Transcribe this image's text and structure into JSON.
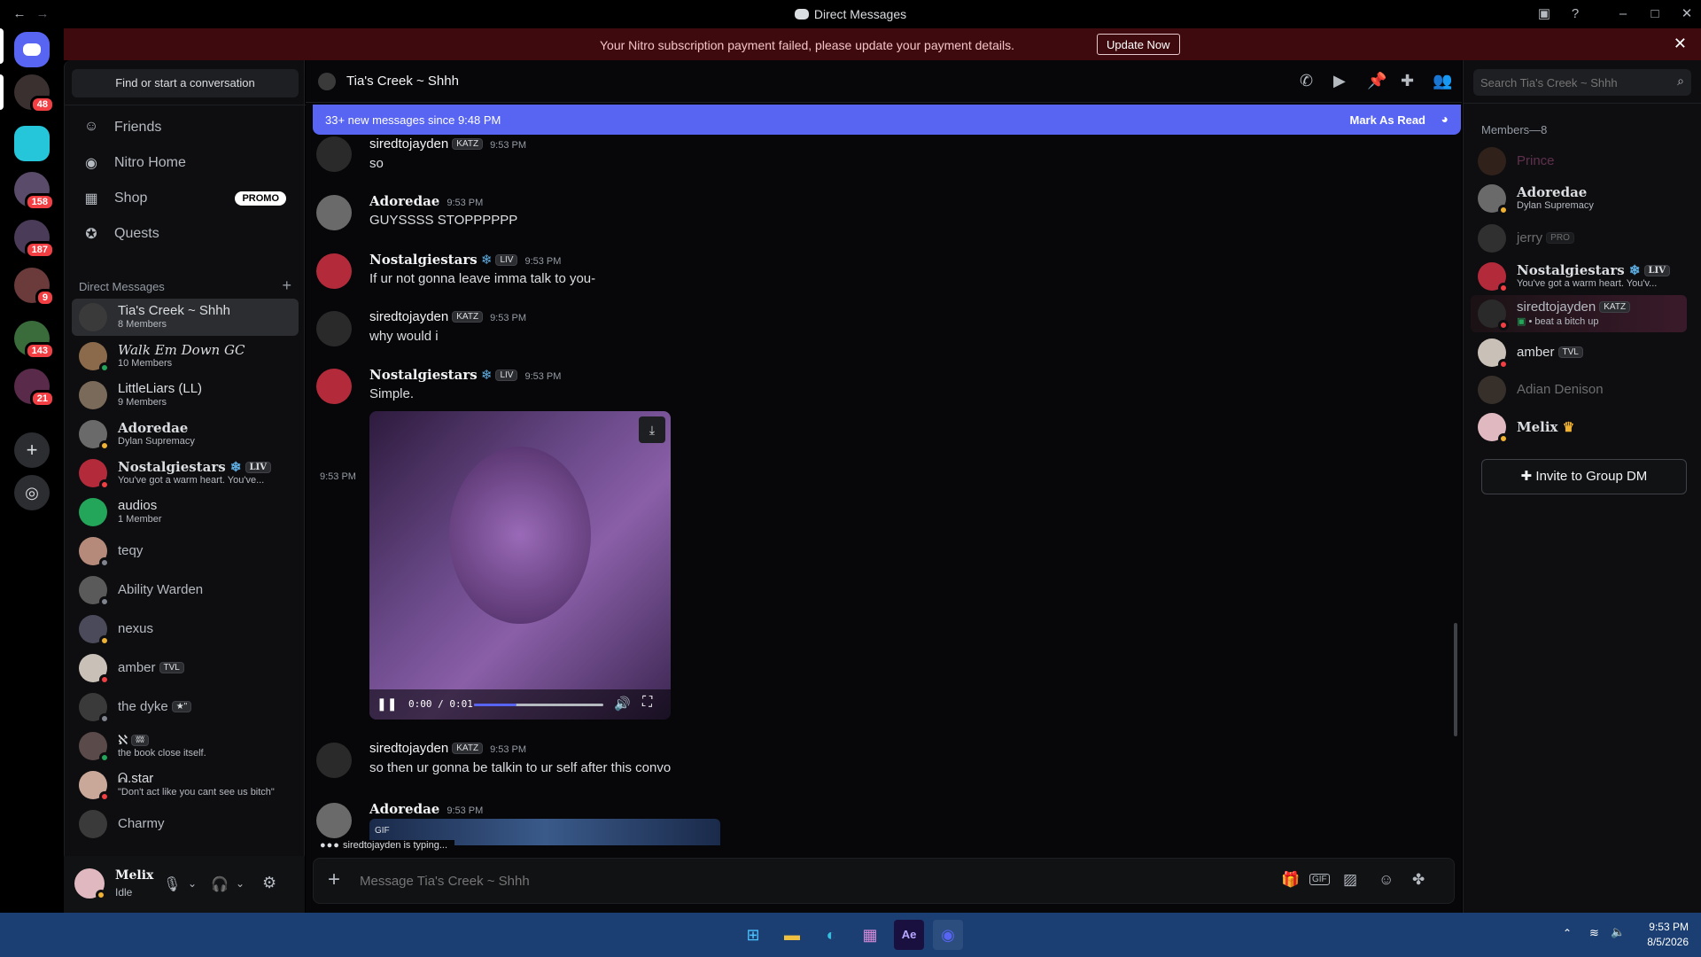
{
  "window": {
    "title": "Direct Messages"
  },
  "banner": {
    "text": "Your Nitro subscription payment failed, please update your payment details.",
    "button": "Update Now"
  },
  "servers": [
    {
      "badge": "48"
    },
    {
      "badge": ""
    },
    {
      "badge": "158"
    },
    {
      "badge": "187"
    },
    {
      "badge": "9"
    },
    {
      "badge": "143"
    },
    {
      "badge": "21"
    }
  ],
  "sidebar": {
    "find": "Find or start a conversation",
    "nav": [
      {
        "label": "Friends"
      },
      {
        "label": "Nitro Home"
      },
      {
        "label": "Shop",
        "badge": "PROMO"
      },
      {
        "label": "Quests"
      }
    ],
    "dm_header": "Direct Messages",
    "dms": [
      {
        "name": "Tia's Creek ~ Shhh",
        "sub": "8 Members"
      },
      {
        "name": "Walk Em Down GC",
        "sub": "10 Members"
      },
      {
        "name": "LittleLiars (LL)",
        "sub": "9 Members"
      },
      {
        "name": "Adoredae",
        "sub": "Dylan Supremacy"
      },
      {
        "name": "Nostalgiestars",
        "tag": "LIV",
        "sub": "You've got a warm heart. You've..."
      },
      {
        "name": "audios",
        "sub": "1 Member"
      },
      {
        "name": "teqy",
        "sub": ""
      },
      {
        "name": "Ability Warden",
        "sub": ""
      },
      {
        "name": "nexus",
        "sub": ""
      },
      {
        "name": "amber",
        "tag": "TVL",
        "sub": ""
      },
      {
        "name": "the dyke",
        "tag": "★\"",
        "sub": ""
      },
      {
        "name": "ℵ",
        "tag": "ʬʬ",
        "sub": "the book close itself."
      },
      {
        "name": "ᕱ.star",
        "sub": "\"Don't act like you cant see us bitch\""
      },
      {
        "name": "Charmy",
        "sub": ""
      }
    ]
  },
  "user": {
    "name": "Melix",
    "status": "Idle"
  },
  "chat": {
    "title": "Tia's Creek ~ Shhh",
    "search_placeholder": "Search Tia's Creek ~ Shhh",
    "new_messages": "33+ new messages since 9:48 PM",
    "mark_read": "Mark As Read",
    "messages": [
      {
        "author": "siredtojayden",
        "tag": "KATZ",
        "time": "9:53 PM",
        "text": "so"
      },
      {
        "author": "Adoredae",
        "tag": "",
        "time": "9:53 PM",
        "text": "GUYSSSS STOPPPPPP"
      },
      {
        "author": "Nostalgiestars",
        "tag": "LIV",
        "time": "9:53 PM",
        "text": "If ur not gonna leave imma talk to you-"
      },
      {
        "author": "siredtojayden",
        "tag": "KATZ",
        "time": "9:53 PM",
        "text": "why would i"
      },
      {
        "author": "Nostalgiestars",
        "tag": "LIV",
        "time": "9:53 PM",
        "text": "Simple."
      },
      {
        "author": "siredtojayden",
        "tag": "KATZ",
        "time": "9:53 PM",
        "text": "so then ur gonna be talkin to ur self after this convo"
      },
      {
        "author": "Adoredae",
        "tag": "",
        "time": "9:53 PM",
        "text": ""
      }
    ],
    "side_time": "9:53 PM",
    "video": {
      "time": "0:00 / 0:01",
      "progress": 0.33
    },
    "typing": "siredtojayden is typing...",
    "gif_label": "GIF",
    "composer_placeholder": "Message Tia's Creek ~ Shhh"
  },
  "members": {
    "header": "Members—8",
    "list": [
      {
        "name": "Prince",
        "sub": ""
      },
      {
        "name": "Adoredae",
        "sub": "Dylan Supremacy"
      },
      {
        "name": "jerry",
        "tag": "PRO",
        "sub": ""
      },
      {
        "name": "Nostalgiestars",
        "tag": "LIV",
        "sub": "You've got a warm heart. You'v..."
      },
      {
        "name": "siredtojayden",
        "tag": "KATZ",
        "sub": "beat a bitch up"
      },
      {
        "name": "amber",
        "tag": "TVL",
        "sub": ""
      },
      {
        "name": "Adian Denison",
        "sub": ""
      },
      {
        "name": "Melix",
        "sub": ""
      }
    ],
    "invite": "Invite to Group DM"
  },
  "taskbar": {
    "time": "9:53 PM",
    "date": "8/5/2026"
  }
}
